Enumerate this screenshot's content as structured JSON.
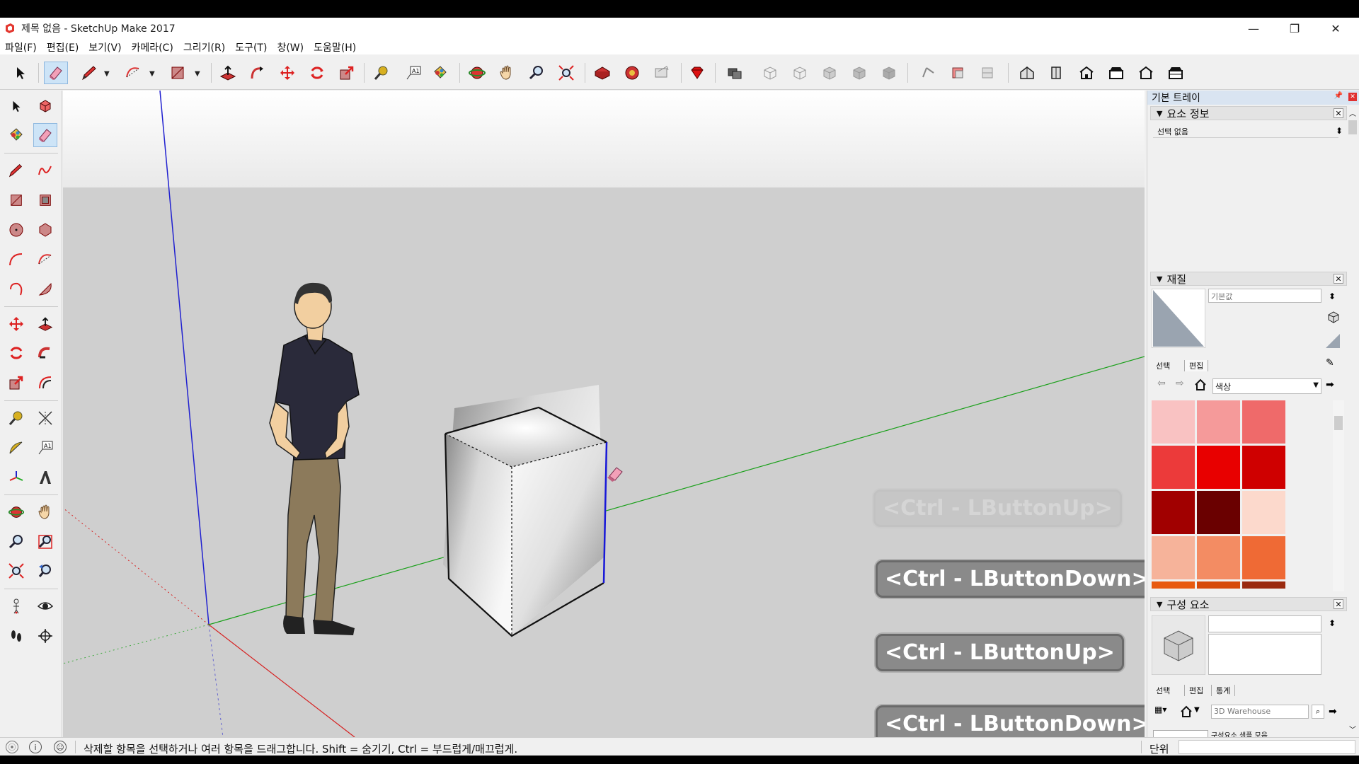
{
  "window": {
    "title": "제목 없음 - SketchUp Make 2017",
    "minimize": "—",
    "restore": "❐",
    "close": "✕"
  },
  "menu": [
    "파일(F)",
    "편집(E)",
    "보기(V)",
    "카메라(C)",
    "그리기(R)",
    "도구(T)",
    "창(W)",
    "도움말(H)"
  ],
  "tray": {
    "title": "기본 트레이",
    "entity_info": {
      "header": "요소 정보",
      "selection": "선택 없음"
    },
    "materials": {
      "header": "재질",
      "name_placeholder": "기본값",
      "tab_select": "선택",
      "tab_edit": "편집",
      "library": "색상",
      "swatches": [
        "#f9c2c2",
        "#f59a9a",
        "#ef6a6a",
        "#ec3a3a",
        "#e80000",
        "#cf0000",
        "#a10000",
        "#6a0000",
        "#fcd9cc",
        "#f6b39a",
        "#f38c63",
        "#ef6a35",
        "#e85a10",
        "#d64a0a",
        "#9a2a10"
      ]
    },
    "components": {
      "header": "구성 요소",
      "tab_select": "선택",
      "tab_edit": "편집",
      "tab_stats": "통계",
      "search_placeholder": "3D Warehouse",
      "list_item": "구성요소 샘플 모음"
    }
  },
  "hints": {
    "faded": "<Ctrl - LButtonUp>",
    "h1": "<Ctrl - LButtonDown>",
    "h2": "<Ctrl - LButtonUp>",
    "h3": "<Ctrl - LButtonDown>"
  },
  "status": {
    "message": "삭제할 항목을 선택하거나 여러 항목을 드래그합니다. Shift = 숨기기, Ctrl = 부드럽게/매끄럽게.",
    "unit_label": "단위"
  },
  "colors": {
    "axis_red": "#d62020",
    "axis_green": "#1aa01a",
    "axis_blue": "#2020d0",
    "sky": "#f1f1f1",
    "ground": "#cfcfcf",
    "selection_blue": "#cde4f7"
  }
}
